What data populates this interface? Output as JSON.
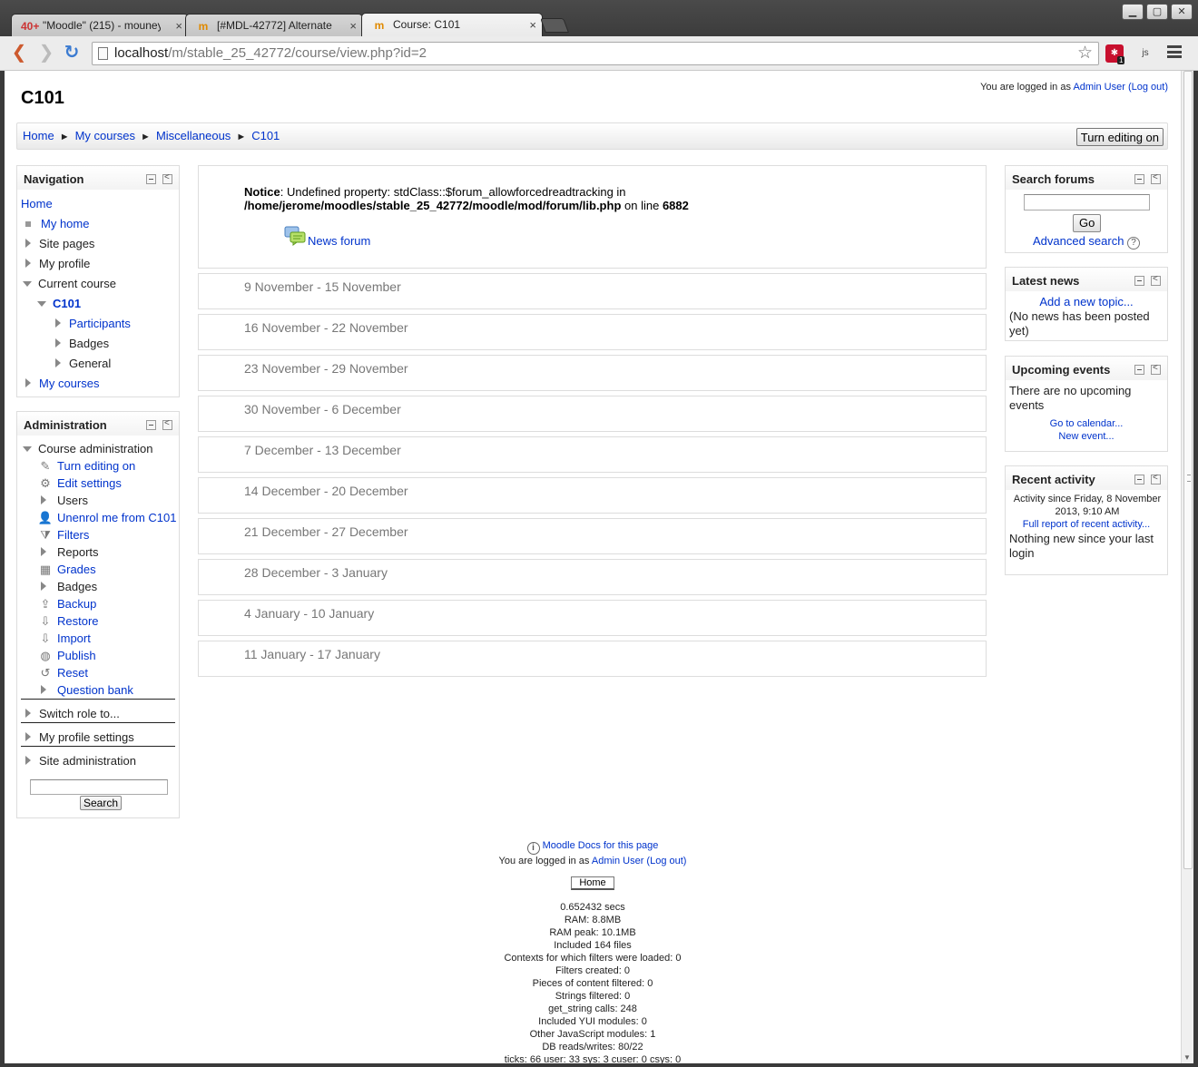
{
  "browser": {
    "tabs": [
      {
        "title": "\"Moodle\" (215) - mouney",
        "favicon": "40+"
      },
      {
        "title": "[#MDL-42772] Alternate",
        "favicon": "m"
      },
      {
        "title": "Course: C101",
        "favicon": "m"
      }
    ],
    "url_host": "localhost",
    "url_path": "/m/stable_25_42772/course/view.php?id=2",
    "ext_badge": "1",
    "ext_js": "js"
  },
  "header": {
    "course_title": "C101",
    "login_prefix": "You are logged in as ",
    "user": "Admin User",
    "logout": "(Log out)"
  },
  "breadcrumb": [
    "Home",
    "My courses",
    "Miscellaneous",
    "C101"
  ],
  "edit_button": "Turn editing on",
  "navigation": {
    "title": "Navigation",
    "home": "Home",
    "my_home": "My home",
    "site_pages": "Site pages",
    "my_profile": "My profile",
    "current_course": "Current course",
    "course": "C101",
    "participants": "Participants",
    "badges": "Badges",
    "general": "General",
    "my_courses": "My courses"
  },
  "administration": {
    "title": "Administration",
    "course_admin": "Course administration",
    "items": [
      {
        "label": "Turn editing on",
        "link": true,
        "icon": "pencil-icon"
      },
      {
        "label": "Edit settings",
        "link": true,
        "icon": "gear-icon"
      },
      {
        "label": "Users",
        "link": false,
        "icon": "arrow"
      },
      {
        "label": "Unenrol me from C101",
        "link": true,
        "icon": "user-icon"
      },
      {
        "label": "Filters",
        "link": true,
        "icon": "filter-icon"
      },
      {
        "label": "Reports",
        "link": false,
        "icon": "arrow"
      },
      {
        "label": "Grades",
        "link": true,
        "icon": "grades-icon"
      },
      {
        "label": "Badges",
        "link": false,
        "icon": "arrow"
      },
      {
        "label": "Backup",
        "link": true,
        "icon": "backup-icon"
      },
      {
        "label": "Restore",
        "link": true,
        "icon": "restore-icon"
      },
      {
        "label": "Import",
        "link": true,
        "icon": "import-icon"
      },
      {
        "label": "Publish",
        "link": true,
        "icon": "globe-icon"
      },
      {
        "label": "Reset",
        "link": true,
        "icon": "reset-icon"
      },
      {
        "label": "Question bank",
        "link": true,
        "icon": "arrow"
      }
    ],
    "switch_role": "Switch role to...",
    "my_profile_settings": "My profile settings",
    "site_admin": "Site administration",
    "search_button": "Search"
  },
  "notice": {
    "label": "Notice",
    "text": ": Undefined property: stdClass::$forum_allowforcedreadtracking in",
    "path": "/home/jerome/moodles/stable_25_42772/moodle/mod/forum/lib.php",
    "on_line": " on line ",
    "line": "6882",
    "forum": "News forum"
  },
  "weeks": [
    "9 November - 15 November",
    "16 November - 22 November",
    "23 November - 29 November",
    "30 November - 6 December",
    "7 December - 13 December",
    "14 December - 20 December",
    "21 December - 27 December",
    "28 December - 3 January",
    "4 January - 10 January",
    "11 January - 17 January"
  ],
  "search_forums": {
    "title": "Search forums",
    "go": "Go",
    "advanced": "Advanced search"
  },
  "latest_news": {
    "title": "Latest news",
    "add": "Add a new topic...",
    "empty": "(No news has been posted yet)"
  },
  "upcoming": {
    "title": "Upcoming events",
    "empty": "There are no upcoming events",
    "calendar": "Go to calendar...",
    "new_event": "New event..."
  },
  "recent": {
    "title": "Recent activity",
    "since": "Activity since Friday, 8 November 2013, 9:10 AM",
    "full_report": "Full report of recent activity...",
    "nothing": "Nothing new since your last login"
  },
  "footer": {
    "docs": "Moodle Docs for this page",
    "login_prefix": "You are logged in as ",
    "user": "Admin User",
    "logout": "(Log out)",
    "home": "Home",
    "perf": [
      "0.652432 secs",
      "RAM: 8.8MB",
      "RAM peak: 10.1MB",
      "Included 164 files",
      "Contexts for which filters were loaded: 0",
      "Filters created: 0",
      "Pieces of content filtered: 0",
      "Strings filtered: 0",
      "get_string calls: 248",
      "Included YUI modules: 0",
      "Other JavaScript modules: 1",
      "DB reads/writes: 80/22",
      "ticks: 66 user: 33 sys: 3 cuser: 0 csys: 0"
    ]
  }
}
